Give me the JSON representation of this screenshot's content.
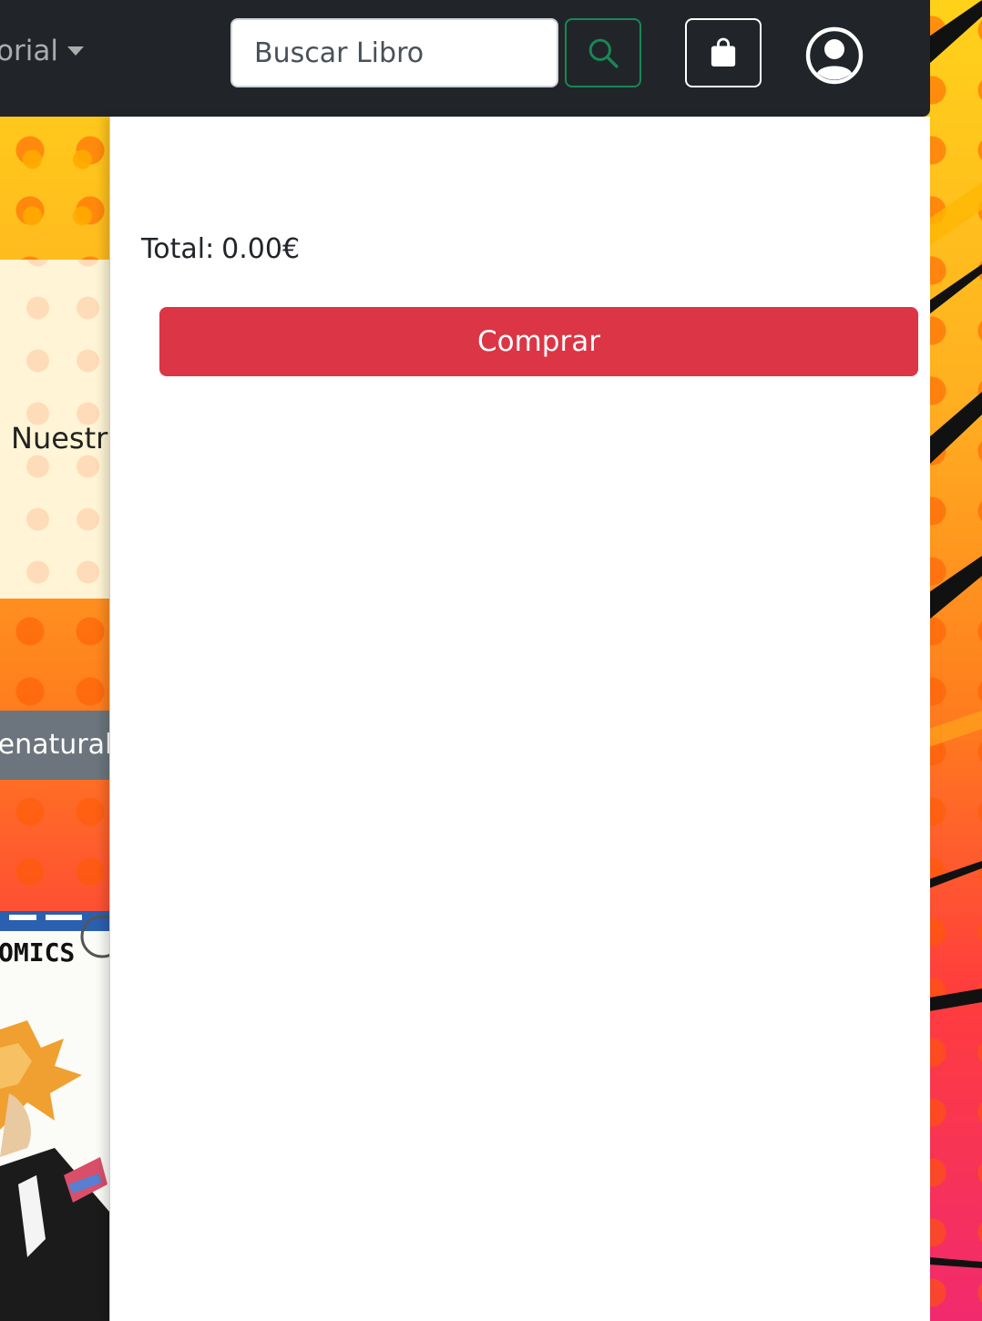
{
  "navbar": {
    "dropdown_label": "orial",
    "search": {
      "placeholder": "Buscar Libro"
    },
    "icons": {
      "search": "search-icon",
      "cart": "shopping-bag-icon",
      "user": "user-circle-icon"
    }
  },
  "background": {
    "promo_text": "Nuestra",
    "genre_label": "renatural",
    "cover_label": "OMICS"
  },
  "cart": {
    "total_label": "Total:",
    "total_value": "0.00€",
    "buy_label": "Comprar"
  },
  "colors": {
    "navbar": "#212529",
    "search_button": "#198754",
    "buy_button": "#dc3545",
    "genre_tag": "#6c757d"
  }
}
